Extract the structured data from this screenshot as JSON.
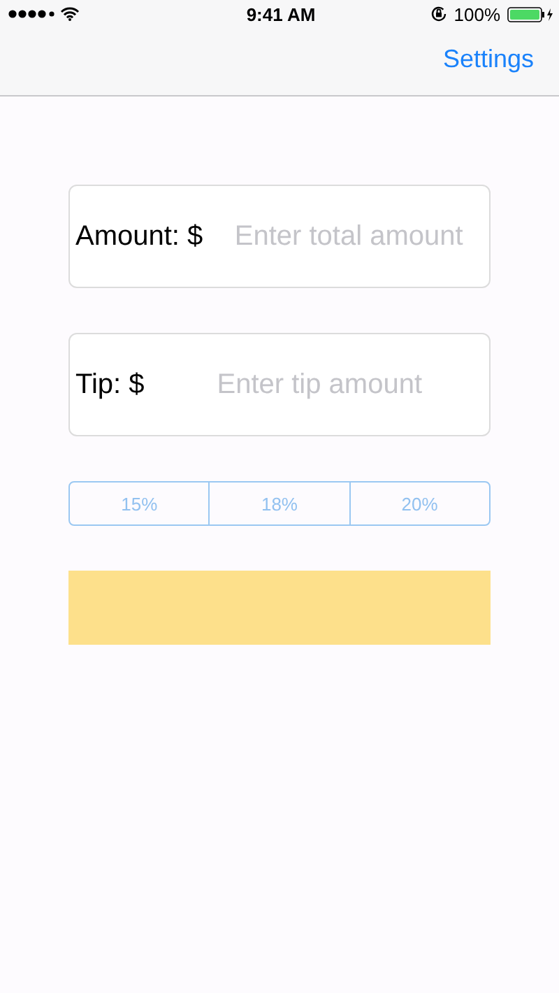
{
  "status_bar": {
    "time": "9:41 AM",
    "battery": "100%"
  },
  "nav_bar": {
    "action": "Settings"
  },
  "fields": [
    {
      "label": "Amount: $",
      "placeholder": "Enter total amount"
    },
    {
      "label": "Tip: $",
      "placeholder": "Enter tip amount"
    }
  ],
  "tip_options": [
    {
      "label": "15%",
      "selected": false
    },
    {
      "label": "18%",
      "selected": false
    },
    {
      "label": "20%",
      "selected": false
    }
  ],
  "result_panel": {
    "color": "#fde08b"
  }
}
